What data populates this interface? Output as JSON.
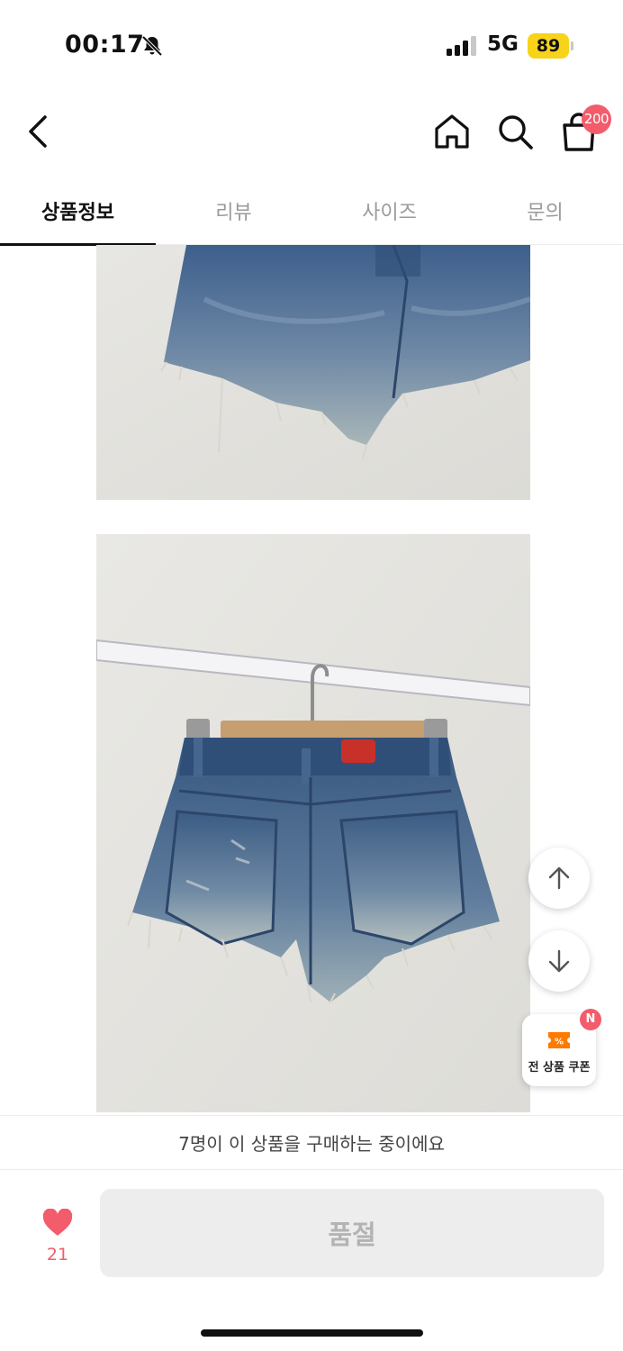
{
  "status_bar": {
    "time": "00:17",
    "network": "5G",
    "battery": "89",
    "icons": [
      "bell-slash-icon",
      "signal-icon",
      "battery-icon"
    ]
  },
  "nav": {
    "icons": [
      "back-icon",
      "home-icon",
      "search-icon",
      "cart-icon"
    ],
    "cart_count": "200"
  },
  "tabs": [
    {
      "label": "상품정보",
      "active": true
    },
    {
      "label": "리뷰",
      "active": false
    },
    {
      "label": "사이즈",
      "active": false
    },
    {
      "label": "문의",
      "active": false
    }
  ],
  "floating": {
    "icons": [
      "arrow-up-icon",
      "arrow-down-icon",
      "coupon-icon"
    ],
    "coupon_label": "전 상품 쿠폰",
    "coupon_badge": "N"
  },
  "banner": {
    "text": "7명이 이 상품을 구매하는 중이에요"
  },
  "bottom_bar": {
    "like_count": "21",
    "action_label": "품절"
  },
  "colors": {
    "accent": "#f25c6b",
    "battery": "#f7d31a",
    "coupon": "#ff7a00",
    "disabled_button": "#ededed",
    "disabled_text": "#b3b3b3"
  }
}
